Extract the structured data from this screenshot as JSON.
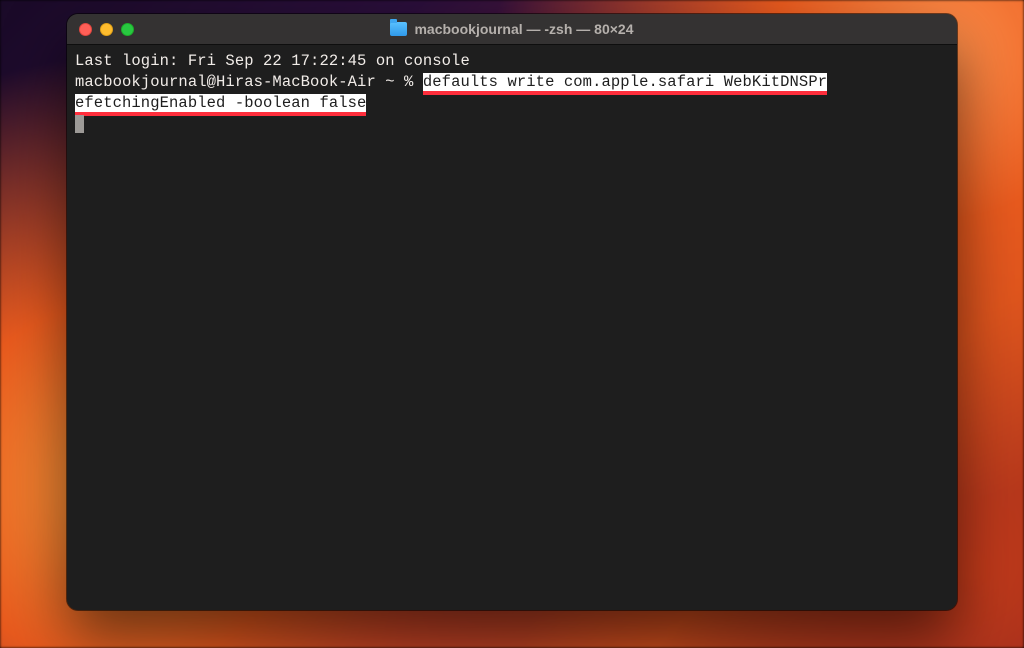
{
  "window": {
    "title": "macbookjournal — -zsh — 80×24",
    "icon": "folder-icon"
  },
  "traffic": {
    "close": "close",
    "min": "minimize",
    "zoom": "zoom"
  },
  "terminal": {
    "last_login": "Last login: Fri Sep 22 17:22:45 on console",
    "prompt": "macbookjournal@Hiras-MacBook-Air ~ % ",
    "cmd_part1": "defaults write com.apple.safari WebKitDNSPr",
    "cmd_part2": "efetchingEnabled -boolean false"
  },
  "annotation": {
    "underline_color": "#ff2e3c"
  }
}
